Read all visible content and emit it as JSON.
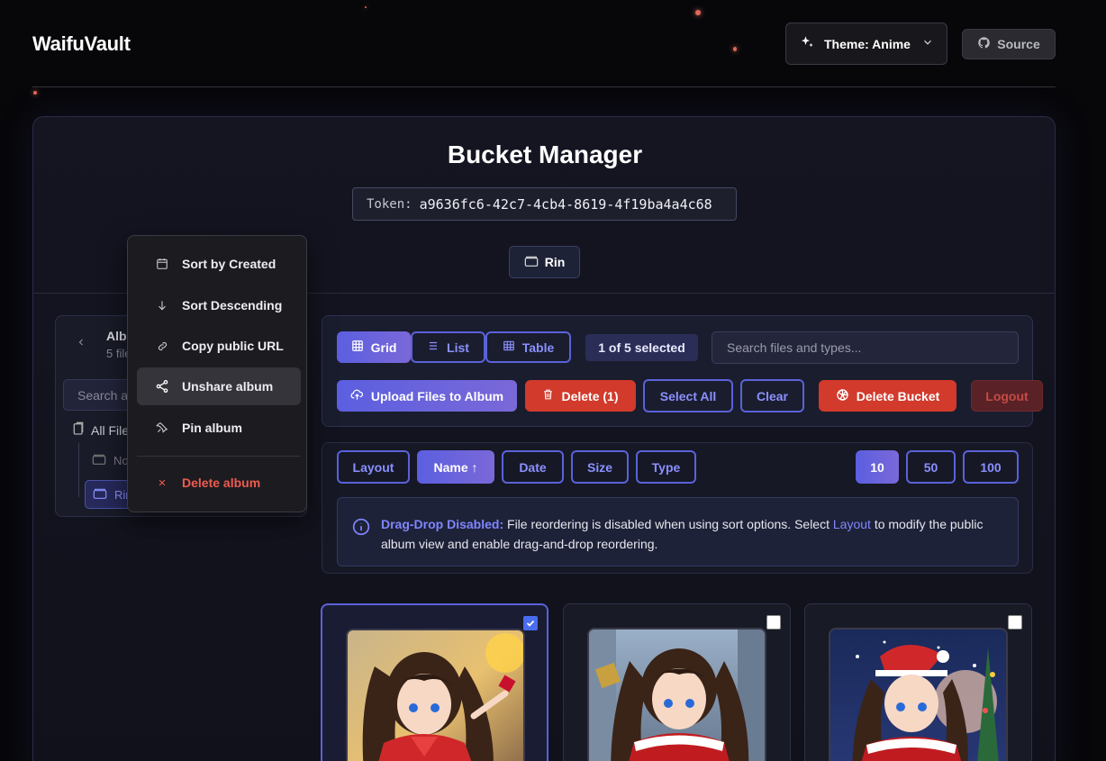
{
  "header": {
    "app_title": "WaifuVault",
    "theme_label": "Theme: Anime",
    "source_label": "Source"
  },
  "bucket": {
    "title": "Bucket Manager",
    "token_label": "Token:",
    "token_value": "a9636fc6-42c7-4cb4-8619-4f19ba4a4c68",
    "current_album": "Rin"
  },
  "sidebar": {
    "title": "Albums",
    "subtitle": "5 files",
    "search_placeholder": "Search albums...",
    "all_files": "All Files",
    "items": [
      {
        "label": "No Album"
      },
      {
        "label": "Rin"
      }
    ]
  },
  "context_menu": {
    "items": [
      {
        "label": "Sort by Created",
        "icon": "calendar-icon"
      },
      {
        "label": "Sort Descending",
        "icon": "arrow-down-icon"
      },
      {
        "label": "Copy public URL",
        "icon": "link-icon"
      },
      {
        "label": "Unshare album",
        "icon": "share-icon",
        "active": true
      },
      {
        "label": "Pin album",
        "icon": "pin-icon"
      },
      {
        "label": "Delete album",
        "icon": "x-icon",
        "danger": true
      }
    ]
  },
  "toolbar": {
    "views": [
      "Grid",
      "List",
      "Table"
    ],
    "active_view": "Grid",
    "selected_count": "1 of 5 selected",
    "search_placeholder": "Search files and types...",
    "upload_label": "Upload Files to Album",
    "delete_label": "Delete (1)",
    "select_all_label": "Select All",
    "clear_label": "Clear",
    "delete_bucket_label": "Delete Bucket",
    "logout_label": "Logout"
  },
  "sort": {
    "options": [
      "Layout",
      "Name ↑",
      "Date",
      "Size",
      "Type"
    ],
    "active": "Name ↑",
    "page_sizes": [
      "10",
      "50",
      "100"
    ],
    "active_page_size": "10"
  },
  "info": {
    "strong": "Drag-Drop Disabled:",
    "text1": "File reordering is disabled when using sort options. Select",
    "link": "Layout",
    "text2": "to modify the public album view and enable drag-and-drop reordering."
  },
  "files": [
    {
      "selected": true
    },
    {
      "selected": false
    },
    {
      "selected": false
    }
  ],
  "colors": {
    "accent": "#5b5fe0",
    "danger": "#d23a2c",
    "background": "#07070a"
  }
}
